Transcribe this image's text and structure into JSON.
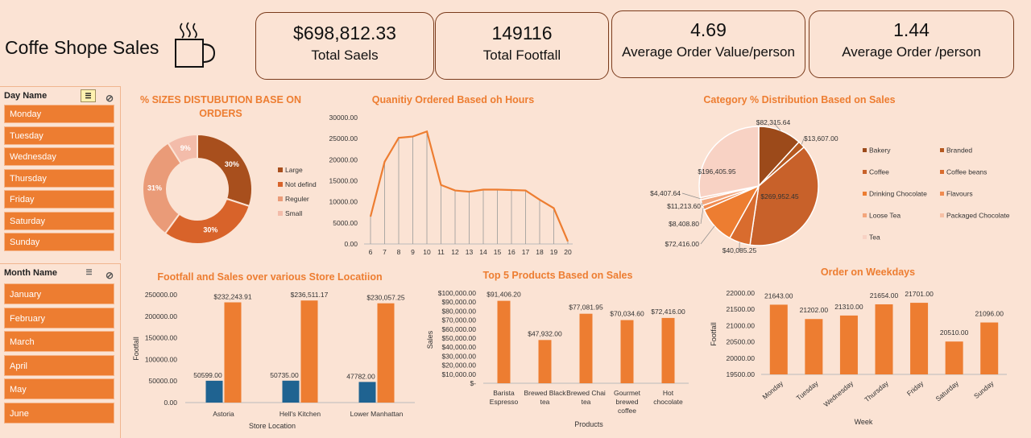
{
  "header": {
    "title": "Coffe Shope Sales",
    "kpis": [
      {
        "value": "$698,812.33",
        "label": "Total Saels"
      },
      {
        "value": "149116",
        "label": "Total Footfall"
      },
      {
        "value": "4.69",
        "label": "Average Order Value/person"
      },
      {
        "value": "1.44",
        "label": "Average Order /person"
      }
    ]
  },
  "slicers": {
    "day": {
      "title": "Day Name",
      "items": [
        "Monday",
        "Tuesday",
        "Wednesday",
        "Thursday",
        "Friday",
        "Saturday",
        "Sunday"
      ]
    },
    "month": {
      "title": "Month Name",
      "items": [
        "January",
        "February",
        "March",
        "April",
        "May",
        "June"
      ]
    }
  },
  "colors": {
    "accent": "#ed7d31",
    "dark": "#9c4a1a",
    "blue": "#1f6391"
  },
  "chart_data": [
    {
      "type": "pie",
      "subtype": "donut",
      "title": "% SIZES DISTUBUTION BASE ON ORDERS",
      "categories": [
        "Large",
        "Not defind",
        "Reguler",
        "Small"
      ],
      "values": [
        30,
        30,
        31,
        9
      ],
      "labels": [
        "30%",
        "30%",
        "31%",
        "9%"
      ],
      "colors": [
        "#a84f1d",
        "#d8632a",
        "#ea9b78",
        "#f3bcaa"
      ],
      "legend": "right"
    },
    {
      "type": "line",
      "title": "Quanitiy Ordered Based oh Hours",
      "x": [
        6,
        7,
        8,
        9,
        10,
        11,
        12,
        13,
        14,
        15,
        16,
        17,
        18,
        19,
        20
      ],
      "values": [
        6500,
        19500,
        25200,
        25500,
        26700,
        14000,
        12700,
        12400,
        12900,
        12900,
        12800,
        12700,
        10500,
        8500,
        600
      ],
      "ylim": [
        0,
        30000
      ],
      "yticks": [
        "0.00",
        "5000.00",
        "10000.00",
        "15000.00",
        "20000.00",
        "25000.00",
        "30000.00"
      ],
      "drop_lines": true
    },
    {
      "type": "pie",
      "title": "Category % Distribution Based on Sales",
      "categories": [
        "Bakery",
        "Branded",
        "Coffee",
        "Coffee beans",
        "Drinking Chocolate",
        "Flavours",
        "Loose Tea",
        "Packaged Chocolate",
        "Tea"
      ],
      "values": [
        82315.64,
        13607.0,
        269952.45,
        40085.25,
        72416.0,
        8408.8,
        11213.6,
        4407.64,
        196405.95
      ],
      "labels": [
        "$82,315.64",
        "$13,607.00",
        "$269,952.45",
        "$40,085.25",
        "$72,416.00",
        "$8,408.80",
        "$11,213.60",
        "$4,407.64",
        "$196,405.95"
      ],
      "colors": [
        "#9c4a1a",
        "#b5581f",
        "#c8612a",
        "#d96c2e",
        "#ed7d31",
        "#f08b50",
        "#f3a67c",
        "#f6bfa4",
        "#f8d2c4"
      ],
      "legend": "right"
    },
    {
      "type": "bar",
      "title": "Footfall and Sales over various Store Locatiion",
      "xlabel": "Store Location",
      "ylabel": "Footfall",
      "categories": [
        "Astoria",
        "Hell's Kitchen",
        "Lower Manhattan"
      ],
      "series": [
        {
          "values": [
            50599,
            50735,
            47782
          ],
          "labels": [
            "50599.00",
            "50735.00",
            "47782.00"
          ],
          "color": "#1f6391"
        },
        {
          "values": [
            232243.91,
            236511.17,
            230057.25
          ],
          "labels": [
            "$232,243.91",
            "$236,511.17",
            "$230,057.25"
          ],
          "color": "#ed7d31"
        }
      ],
      "ylim": [
        0,
        250000
      ],
      "yticks": [
        "0.00",
        "50000.00",
        "100000.00",
        "150000.00",
        "200000.00",
        "250000.00"
      ]
    },
    {
      "type": "bar",
      "title": "Top 5 Products Based on Sales",
      "xlabel": "Products",
      "ylabel": "Sales",
      "categories": [
        "Barista Espresso",
        "Brewed Black tea",
        "Brewed Chai tea",
        "Gourmet brewed coffee",
        "Hot chocolate"
      ],
      "values": [
        91406.2,
        47932.0,
        77081.95,
        70034.6,
        72416.0
      ],
      "labels": [
        "$91,406.20",
        "$47,932.00",
        "$77,081.95",
        "$70,034.60",
        "$72,416.00"
      ],
      "ylim": [
        0,
        100000
      ],
      "yticks": [
        "$-",
        "$10,000.00",
        "$20,000.00",
        "$30,000.00",
        "$40,000.00",
        "$50,000.00",
        "$60,000.00",
        "$70,000.00",
        "$80,000.00",
        "$90,000.00",
        "$100,000.00"
      ]
    },
    {
      "type": "bar",
      "title": "Order on Weekdays",
      "xlabel": "Week",
      "ylabel": "Footfall",
      "categories": [
        "Monday",
        "Tuesday",
        "Wednesday",
        "Thursday",
        "Friday",
        "Saturday",
        "Sunday"
      ],
      "values": [
        21643,
        21202,
        21310,
        21654,
        21701,
        20510,
        21096
      ],
      "labels": [
        "21643.00",
        "21202.00",
        "21310.00",
        "21654.00",
        "21701.00",
        "20510.00",
        "21096.00"
      ],
      "ylim": [
        19500,
        22000
      ],
      "yticks": [
        "19500.00",
        "20000.00",
        "20500.00",
        "21000.00",
        "21500.00",
        "22000.00"
      ]
    }
  ]
}
